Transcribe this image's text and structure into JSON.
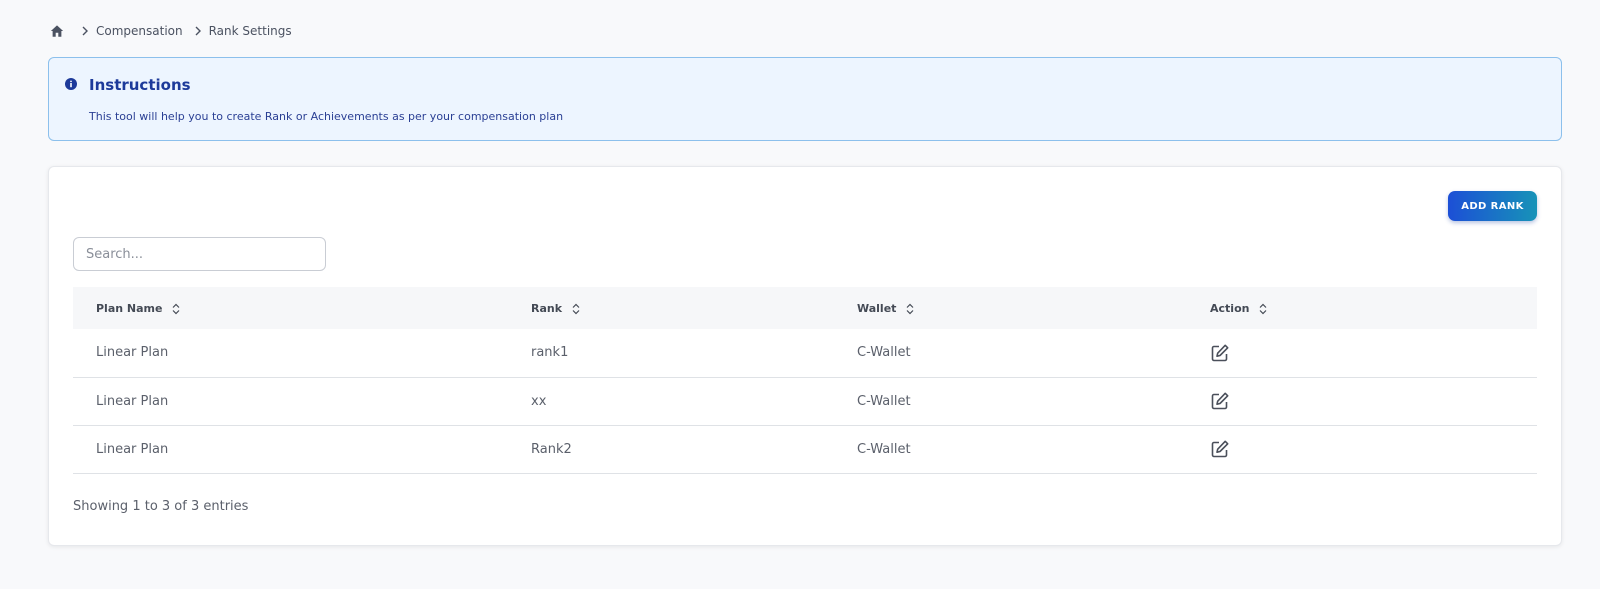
{
  "breadcrumb": {
    "items": [
      "Compensation",
      "Rank Settings"
    ]
  },
  "instructions": {
    "title": "Instructions",
    "description": "This tool will help you to create Rank or Achievements as per your compensation plan"
  },
  "toolbar": {
    "add_label": "ADD RANK"
  },
  "search": {
    "placeholder": "Search..."
  },
  "table": {
    "columns": [
      "Plan Name",
      "Rank",
      "Wallet",
      "Action"
    ],
    "rows": [
      {
        "plan": "Linear Plan",
        "rank": "rank1",
        "wallet": "C-Wallet"
      },
      {
        "plan": "Linear Plan",
        "rank": "xx",
        "wallet": "C-Wallet"
      },
      {
        "plan": "Linear Plan",
        "rank": "Rank2",
        "wallet": "C-Wallet"
      }
    ]
  },
  "footer": {
    "entries_text": "Showing 1 to 3 of 3 entries"
  },
  "colors": {
    "accent_start": "#1c4fd6",
    "accent_end": "#1793b8",
    "info": "#1d3a9a"
  }
}
